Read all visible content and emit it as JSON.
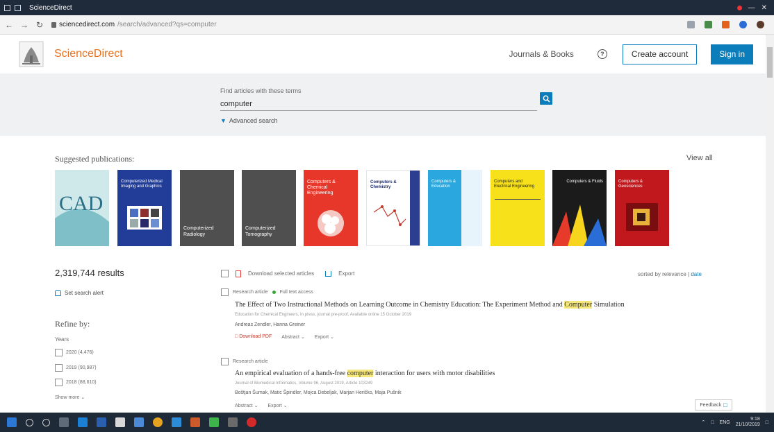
{
  "browser": {
    "title": "ScienceDirect",
    "url_host": "sciencedirect.com",
    "url_path": "/search/advanced?qs=computer",
    "icons": [
      "back-icon",
      "forward-icon",
      "reload-icon",
      "lock-icon",
      "star-icon",
      "extension-icon",
      "profile-icon"
    ]
  },
  "header": {
    "brand": "ScienceDirect",
    "journals_books": "Journals & Books",
    "help_glyph": "?",
    "create_account": "Create account",
    "sign_in": "Sign in"
  },
  "search": {
    "label": "Find articles with these terms",
    "value": "computer",
    "advanced": "Advanced search"
  },
  "suggested": {
    "title": "Suggested publications:",
    "view_all": "View all",
    "covers": [
      {
        "label": "CAD",
        "bg": "#bfe0e4",
        "fg": "#2b6f86"
      },
      {
        "label": "Computerized Medical Imaging and Graphics",
        "bg": "#213d97",
        "fg": "#ffffff"
      },
      {
        "label": "Computerized Radiology",
        "bg": "#4f4f4f",
        "fg": "#ffffff"
      },
      {
        "label": "Computerized Tomography",
        "bg": "#4f4f4f",
        "fg": "#ffffff"
      },
      {
        "label": "Computers & Chemical Engineering",
        "bg": "#e7372a",
        "fg": "#ffffff"
      },
      {
        "label": "Computers & Chemistry",
        "bg": "#ffffff",
        "fg": "#1d2d6b"
      },
      {
        "label": "Computers & Education",
        "bg": "#2aa7de",
        "fg": "#ffffff"
      },
      {
        "label": "Computers and Electrical Engineering",
        "bg": "#f7e11a",
        "fg": "#222222"
      },
      {
        "label": "Computers & Fluids",
        "bg": "#1b1b1b",
        "fg": "#ffffff"
      },
      {
        "label": "Computers & Geosciences",
        "bg": "#c0181d",
        "fg": "#ffffff"
      }
    ]
  },
  "filters": {
    "results_count": "2,319,744 results",
    "search_alert": "Set search alert",
    "refine_by": "Refine by:",
    "years_label": "Years",
    "years": [
      "2020 (4,476)",
      "2019 (90,987)",
      "2018 (88,610)"
    ],
    "show_more": "Show more"
  },
  "toolbar": {
    "download_selected": "Download selected articles",
    "export": "Export",
    "sorted_by": "sorted by relevance |",
    "date": "date"
  },
  "results": [
    {
      "type": "Research article",
      "access": "Full text access",
      "title_before": "The Effect of Two Instructional Methods on Learning Outcome in Chemistry Education: The Experiment Method and ",
      "title_highlight": "Computer",
      "title_after": " Simulation",
      "source": "Education for Chemical Engineers, In press, journal pre-proof, Available online 15 October 2019",
      "authors": "Andreas Zendler, Hanna Greiner",
      "action_pdf": "Download PDF",
      "action_abstract": "Abstract",
      "action_export": "Export"
    },
    {
      "type": "Research article",
      "title_before": "An empirical evaluation of a hands-free ",
      "title_highlight": "computer",
      "title_after": " interaction for users with motor disabilities",
      "source": "Journal of Biomedical Informatics, Volume 96, August 2019, Article 103249",
      "authors": "Boštjan Šumak, Matic Špindler, Mojca Debeljak, Marjan Heričko, Maja Pušnik",
      "action_abstract": "Abstract",
      "action_export": "Export"
    }
  ],
  "feedback": "Feedback",
  "taskbar": {
    "tray_lang": "ENG",
    "tray_time": "9:18",
    "tray_date": "21/10/2019"
  },
  "colors": {
    "brand_orange": "#e9711c",
    "primary_blue": "#0c7dbb",
    "highlight": "#f6e77a"
  }
}
